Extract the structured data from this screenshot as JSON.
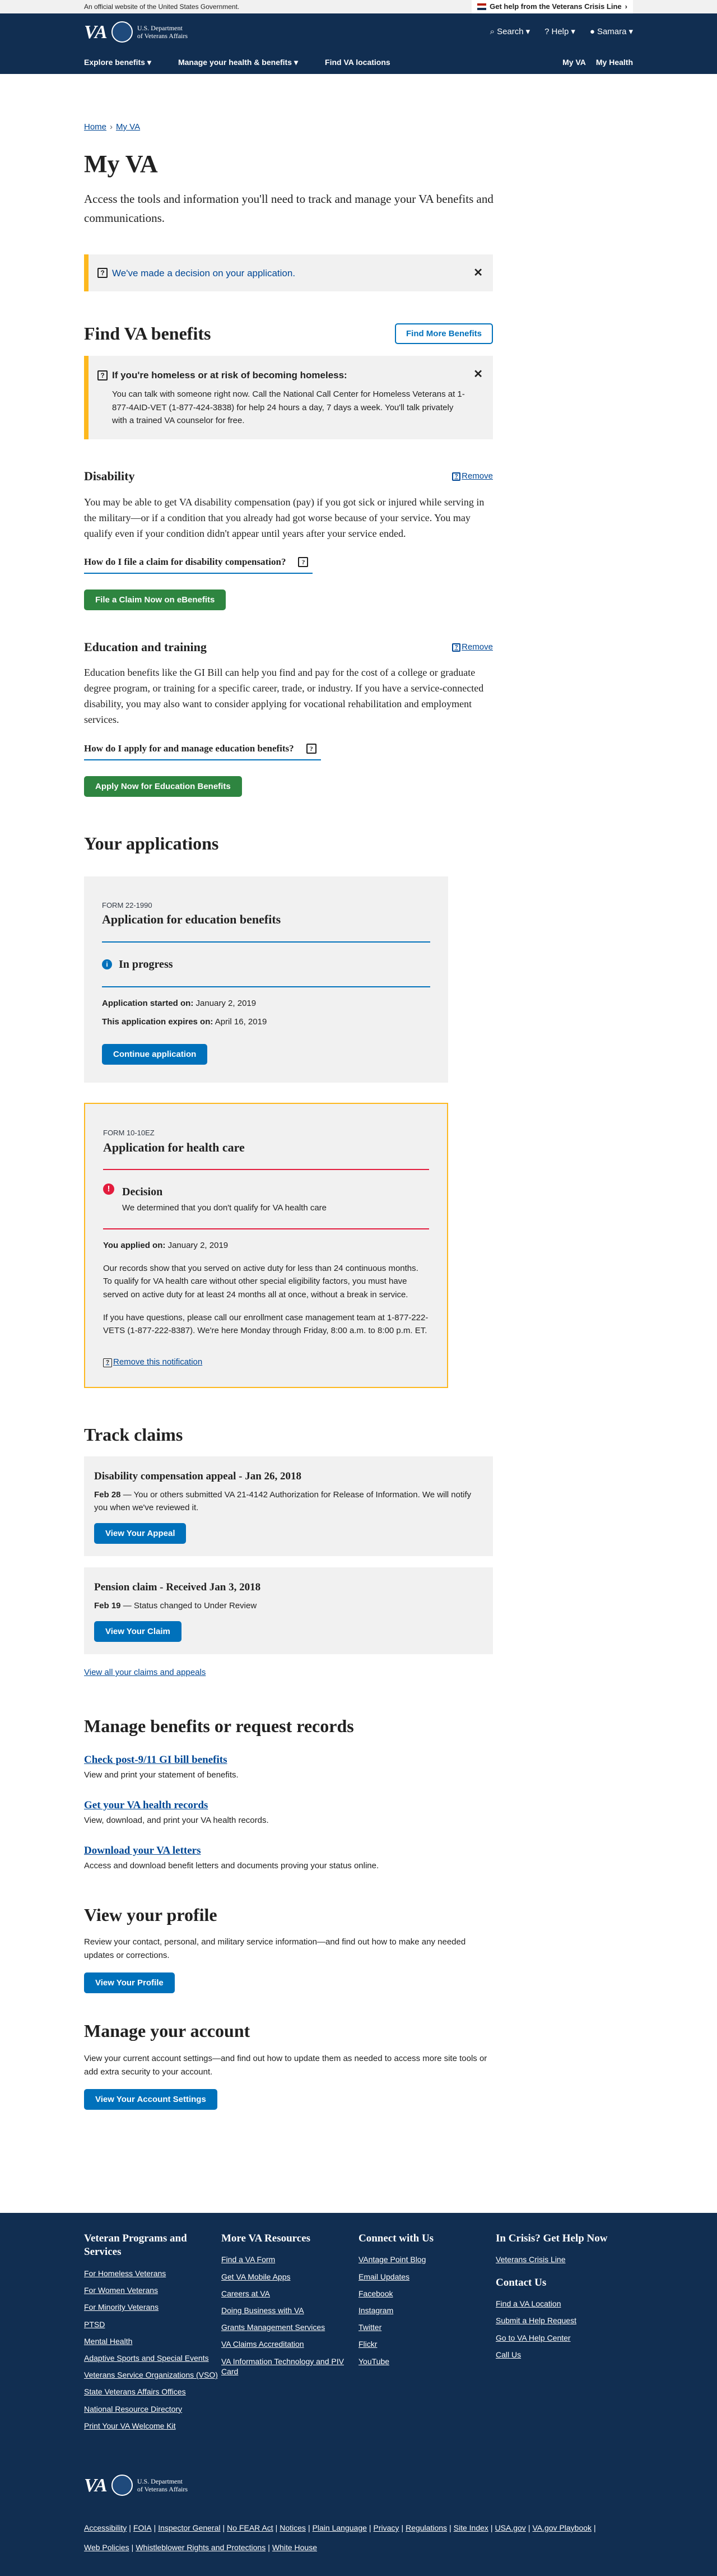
{
  "official_banner": "An official website of the United States Government.",
  "crisis_line": "Get help from the Veterans Crisis Line",
  "header": {
    "logo_va": "VA",
    "logo_line1": "U.S. Department",
    "logo_line2": "of Veterans Affairs",
    "utility": [
      {
        "label": "Search",
        "icon": "search-icon"
      },
      {
        "label": "Help",
        "icon": "help-icon"
      },
      {
        "label": "Samara",
        "icon": "user-icon"
      }
    ],
    "nav": [
      "Explore benefits",
      "Manage your health & benefits",
      "Find VA locations"
    ],
    "nav_right": [
      "My VA",
      "My Health"
    ]
  },
  "breadcrumb": [
    "Home",
    "My VA"
  ],
  "page": {
    "title": "My VA",
    "lead": "Access the tools and information you'll need to track and manage your VA benefits and communications."
  },
  "decision_alert": {
    "text": "We've made a decision on your application."
  },
  "find_benefits": {
    "title": "Find VA benefits",
    "button": "Find More Benefits",
    "homeless_alert": {
      "title": "If you're homeless or at risk of becoming homeless:",
      "body": "You can talk with someone right now. Call the National Call Center for Homeless Veterans at 1-877-4AID-VET (1-877-424-3838) for help 24 hours a day, 7 days a week. You'll talk privately with a trained VA counselor for free."
    },
    "disability": {
      "title": "Disability",
      "remove": "Remove",
      "body": "You may be able to get VA disability compensation (pay) if you got sick or injured while serving in the military—or if a condition that you already had got worse because of your service. You may qualify even if your condition didn't appear until years after your service ended.",
      "faq": "How do I file a claim for disability compensation?",
      "button": "File a Claim Now on eBenefits"
    },
    "education": {
      "title": "Education and training",
      "remove": "Remove",
      "body": "Education benefits like the GI Bill can help you find and pay for the cost of a college or graduate degree program, or training for a specific career, trade, or industry. If you have a service-connected disability, you may also want to consider applying for vocational rehabilitation and employment services.",
      "faq": "How do I apply for and manage education benefits?",
      "button": "Apply Now for Education Benefits"
    }
  },
  "applications": {
    "title": "Your applications",
    "education": {
      "form": "FORM 22-1990",
      "title": "Application for education benefits",
      "status": "In progress",
      "started_label": "Application started on:",
      "started": "January 2, 2019",
      "expires_label": "This application expires on:",
      "expires": "April 16, 2019",
      "button": "Continue application"
    },
    "health": {
      "form": "FORM 10-10EZ",
      "title": "Application for health care",
      "status": "Decision",
      "status_detail": "We determined that you don't qualify for VA health care",
      "applied_label": "You applied on:",
      "applied": "January 2, 2019",
      "body1": "Our records show that you served on active duty for less than 24 continuous months. To qualify for VA health care without other special eligibility factors, you must have served on active duty for at least 24 months all at once, without a break in service.",
      "body2": "If you have questions, please call our enrollment case management team at 1-877-222-VETS (1-877-222-8387). We're here Monday through Friday, 8:00 a.m. to 8:00 p.m. ET.",
      "remove": "Remove this notification"
    }
  },
  "claims": {
    "title": "Track claims",
    "items": [
      {
        "title": "Disability compensation appeal - Jan 26, 2018",
        "date": "Feb 28",
        "text": " — You or others submitted VA 21-4142 Authorization for Release of Information. We will notify you when we've reviewed it.",
        "button": "View Your Appeal"
      },
      {
        "title": "Pension claim - Received Jan 3, 2018",
        "date": "Feb 19",
        "text": " — Status changed to Under Review",
        "button": "View Your Claim"
      }
    ],
    "view_all": "View all your claims and appeals"
  },
  "records": {
    "title": "Manage benefits or request records",
    "items": [
      {
        "link": "Check post-9/11 GI bill benefits",
        "desc": "View and print your statement of benefits."
      },
      {
        "link": "Get your VA health records",
        "desc": "View, download, and print your VA health records."
      },
      {
        "link": "Download your VA letters",
        "desc": "Access and download benefit letters and documents proving your status online."
      }
    ]
  },
  "profile": {
    "title": "View your profile",
    "text": "Review your contact, personal, and military service information—and find out how to make any needed updates or corrections.",
    "button": "View Your Profile"
  },
  "account": {
    "title": "Manage your account",
    "text": "View your current account settings—and find out how to update them as needed to access more site tools or add extra security to your account.",
    "button": "View Your Account Settings"
  },
  "footer": {
    "col1": {
      "title": "Veteran Programs and Services",
      "links": [
        "For Homeless Veterans",
        "For Women Veterans",
        "For Minority Veterans",
        "PTSD",
        "Mental Health",
        "Adaptive Sports and Special Events",
        "Veterans Service Organizations (VSO)",
        "State Veterans Affairs Offices",
        "National Resource Directory",
        "Print Your VA Welcome Kit"
      ]
    },
    "col2": {
      "title": "More VA Resources",
      "links": [
        "Find a VA Form",
        "Get VA Mobile Apps",
        "Careers at VA",
        "Doing Business with VA",
        "Grants Management Services",
        "VA Claims Accreditation",
        "VA Information Technology and PIV Card"
      ]
    },
    "col3": {
      "title": "Connect with Us",
      "links": [
        "VAntage Point Blog",
        "Email Updates",
        "Facebook",
        "Instagram",
        "Twitter",
        "Flickr",
        "YouTube"
      ]
    },
    "col4": {
      "title": "In Crisis? Get Help Now",
      "links": [
        "Veterans Crisis Line"
      ],
      "title2": "Contact Us",
      "links2": [
        "Find a VA Location",
        "Submit a Help Request",
        "Go to VA Help Center",
        "Call Us"
      ]
    },
    "bottom_links": [
      "Accessibility",
      "FOIA",
      "Inspector General",
      "No FEAR Act",
      "Notices",
      "Plain Language",
      "Privacy",
      "Regulations",
      "Site Index",
      "USA.gov",
      "VA.gov Playbook",
      "Web Policies",
      "Whistleblower Rights and Protections",
      "White House"
    ]
  },
  "colors": {
    "navy": "#112e51",
    "primary": "#0071bb",
    "green": "#2e8540",
    "warning": "#fdb81e",
    "error": "#e31c3d",
    "gray_bg": "#f1f1f1"
  }
}
